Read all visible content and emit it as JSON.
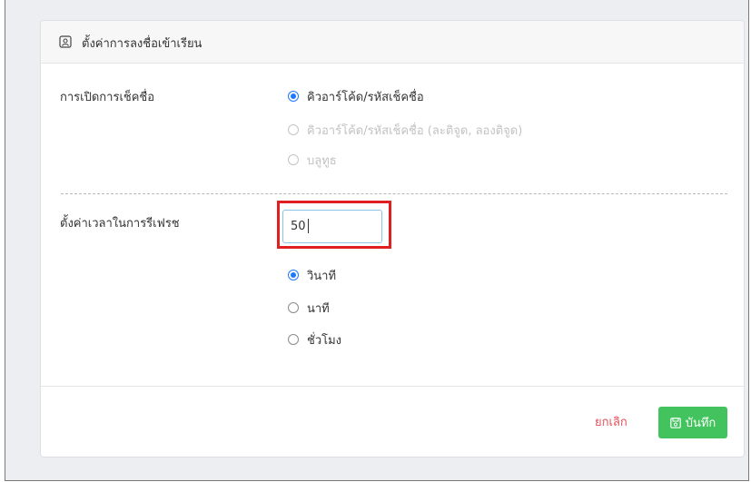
{
  "card": {
    "title": "ตั้งค่าการลงชื่อเข้าเรียน",
    "header_icon": "user-frame-icon"
  },
  "checkin": {
    "label": "การเปิดการเช็คชื่อ",
    "options": [
      {
        "label": "คิวอาร์โค้ด/รหัสเช็คชื่อ",
        "checked": true,
        "disabled": false
      },
      {
        "label": "คิวอาร์โค้ด/รหัสเช็คชื่อ (ละติจูด, ลองติจูด)",
        "checked": false,
        "disabled": true
      },
      {
        "label": "บลูทูธ",
        "checked": false,
        "disabled": true
      }
    ]
  },
  "refresh": {
    "label": "ตั้งค่าเวลาในการรีเฟรช",
    "value": "50",
    "units": [
      {
        "label": "วินาที",
        "checked": true
      },
      {
        "label": "นาที",
        "checked": false
      },
      {
        "label": "ชั่วโมง",
        "checked": false
      }
    ]
  },
  "footer": {
    "cancel_label": "ยกเลิก",
    "save_label": "บันทึก",
    "save_icon": "save-icon"
  },
  "colors": {
    "accent": "#1e78ff",
    "save": "#43c35e",
    "cancel": "#e0505a",
    "highlight": "#e02020"
  }
}
